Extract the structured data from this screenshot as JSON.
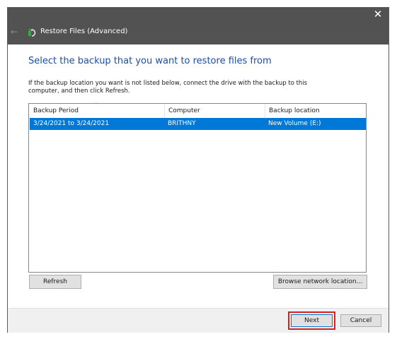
{
  "window": {
    "title": "Restore Files (Advanced)",
    "close_glyph": "✕",
    "back_glyph": "←",
    "app_icon": "restore-files-icon"
  },
  "content": {
    "heading": "Select the backup that you want to restore files from",
    "instructions_line1": "If the backup location you want is not listed below, connect the drive with the backup to this",
    "instructions_line2": "computer, and then click Refresh."
  },
  "list": {
    "columns": [
      "Backup Period",
      "Computer",
      "Backup location"
    ],
    "sort_glyph": "⌄",
    "rows": [
      {
        "period": "3/24/2021 to 3/24/2021",
        "computer": "BRITHNY",
        "location": "New Volume (E:)",
        "selected": true
      }
    ]
  },
  "buttons": {
    "refresh": "Refresh",
    "browse": "Browse network location...",
    "next": "Next",
    "cancel": "Cancel"
  },
  "colors": {
    "titlebar": "#525252",
    "heading": "#1c4ea0",
    "selection": "#0078d7",
    "highlight_box": "#d9201c"
  }
}
